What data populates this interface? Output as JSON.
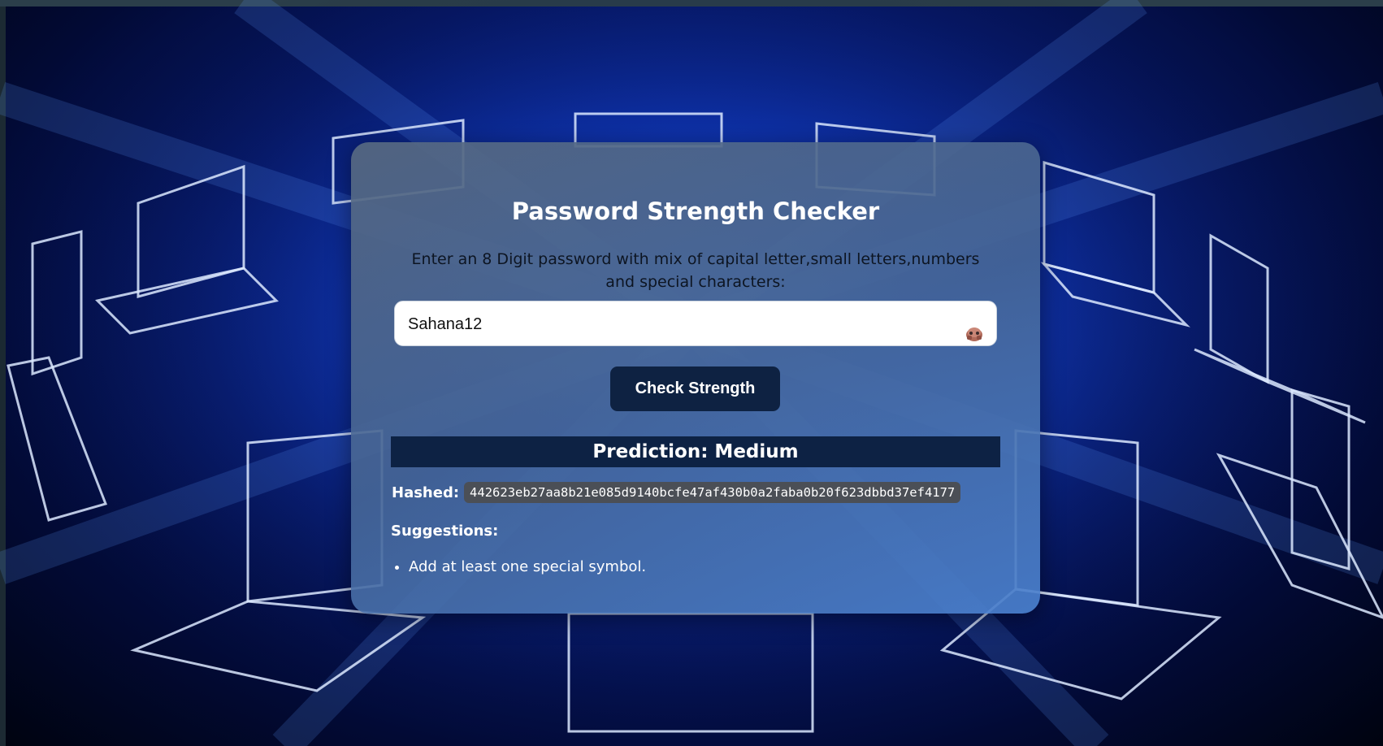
{
  "app": {
    "title": "Password Strength Checker",
    "instruction": "Enter an 8 Digit password with mix of capital letter,small letters,numbers and special characters:"
  },
  "form": {
    "password_value": "Sahana12",
    "toggle_icon": "eye-peek-icon",
    "check_button_label": "Check Strength"
  },
  "result": {
    "prediction": "Prediction: Medium",
    "hashed_label": "Hashed:",
    "hashed_value": "442623eb27aa8b21e085d9140bcfe47af430b0a2faba0b20f623dbbd37ef4177",
    "suggestions_heading": "Suggestions:",
    "suggestions": [
      "Add at least one special symbol."
    ]
  },
  "colors": {
    "button_bg": "#0e2242",
    "prediction_bg": "#0d2244",
    "hash_bg": "#4b4f56",
    "background_glow": "#1a4fd6"
  }
}
